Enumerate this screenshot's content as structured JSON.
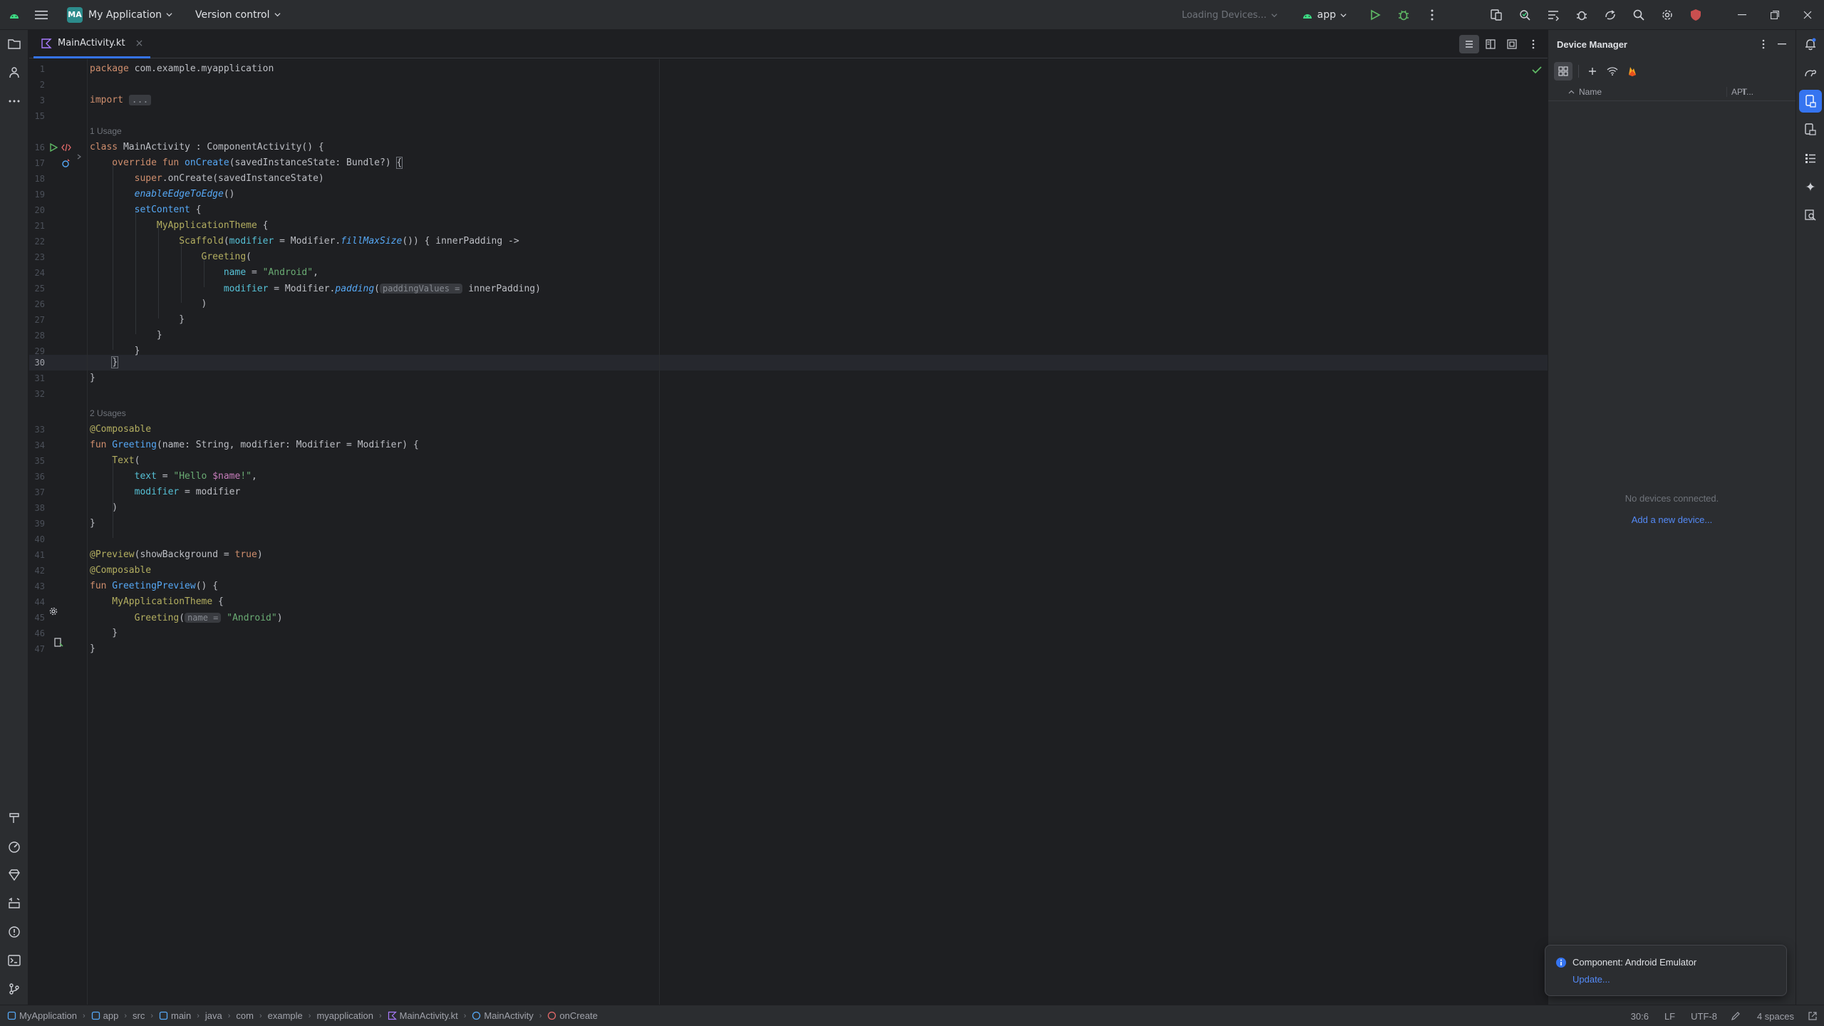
{
  "titlebar": {
    "project_badge": "MA",
    "project_name": "My Application",
    "vcs_label": "Version control",
    "device_selector": "Loading Devices...",
    "run_config": "app"
  },
  "tabs": [
    {
      "label": "MainActivity.kt"
    }
  ],
  "editor": {
    "hints": {
      "h1": "1 Usage",
      "h2": "2 Usages"
    },
    "lines": {
      "l1": "1",
      "l2": "2",
      "l3": "3",
      "l15": "15",
      "l16": "16",
      "l17": "17",
      "l18": "18",
      "l19": "19",
      "l20": "20",
      "l21": "21",
      "l22": "22",
      "l23": "23",
      "l24": "24",
      "l25": "25",
      "l26": "26",
      "l27": "27",
      "l28": "28",
      "l29": "29",
      "l30": "30",
      "l31": "31",
      "l32": "32",
      "l33": "33",
      "l34": "34",
      "l35": "35",
      "l36": "36",
      "l37": "37",
      "l38": "38",
      "l39": "39",
      "l40": "40",
      "l41": "41",
      "l42": "42",
      "l43": "43",
      "l44": "44",
      "l45": "45",
      "l46": "46",
      "l47": "47"
    },
    "code": {
      "c1a": "package",
      "c1b": " com.example.myapplication",
      "c3a": "import",
      "c3b": "...",
      "c16a": "class",
      "c16b": " MainActivity : ComponentActivity() {",
      "c17a": "    override fun",
      "c17b": " onCreate",
      "c17c": "(savedInstanceState: Bundle?) ",
      "c17d": "{",
      "c18a": "        super",
      "c18b": ".onCreate(savedInstanceState)",
      "c19a": "        enableEdgeToEdge",
      "c19b": "()",
      "c20a": "        setContent",
      "c20b": " {",
      "c21a": "            MyApplicationTheme",
      "c21b": " {",
      "c22a": "                Scaffold",
      "c22b": "(",
      "c22c": "modifier",
      "c22d": " = Modifier.",
      "c22e": "fillMaxSize",
      "c22f": "()) { innerPadding ->",
      "c23a": "                    Greeting",
      "c23b": "(",
      "c24a": "                        name",
      "c24b": " = ",
      "c24c": "\"Android\"",
      "c24d": ",",
      "c25a": "                        modifier",
      "c25b": " = Modifier.",
      "c25c": "padding",
      "c25d": "(",
      "c25e": "paddingValues =",
      "c25f": " innerPadding)",
      "c26a": "                    )",
      "c27a": "                }",
      "c28a": "            }",
      "c29a": "        }",
      "c30a": "    ",
      "c30b": "}",
      "c31a": "}",
      "c33a": "@Composable",
      "c34a": "fun",
      "c34b": " Greeting",
      "c34c": "(name: String, modifier: Modifier = Modifier) {",
      "c35a": "    Text",
      "c35b": "(",
      "c36a": "        text",
      "c36b": " = ",
      "c36c": "\"Hello ",
      "c36d": "$name",
      "c36e": "!\"",
      "c36f": ",",
      "c37a": "        modifier",
      "c37b": " = modifier",
      "c38a": "    )",
      "c39a": "}",
      "c41a": "@Preview",
      "c41b": "(showBackground = ",
      "c41c": "true",
      "c41d": ")",
      "c42a": "@Composable",
      "c43a": "fun",
      "c43b": " GreetingPreview",
      "c43c": "() {",
      "c44a": "    MyApplicationTheme",
      "c44b": " {",
      "c45a": "        Greeting",
      "c45b": "(",
      "c45c": "name =",
      "c45d": " ",
      "c45e": "\"Android\"",
      "c45f": ")",
      "c46a": "    }",
      "c47a": "}"
    }
  },
  "device_manager": {
    "title": "Device Manager",
    "col_name": "Name",
    "col_api": "API",
    "col_type": "T...",
    "empty_text": "No devices connected.",
    "add_link": "Add a new device..."
  },
  "notification": {
    "title": "Component: Android Emulator",
    "link": "Update..."
  },
  "statusbar": {
    "crumbs": [
      "MyApplication",
      "app",
      "src",
      "main",
      "java",
      "com",
      "example",
      "myapplication",
      "MainActivity.kt",
      "MainActivity",
      "onCreate"
    ],
    "position": "30:6",
    "line_sep": "LF",
    "encoding": "UTF-8",
    "indent": "4 spaces"
  },
  "colors": {
    "accent": "#3574f0",
    "background": "#1e1f22",
    "panel": "#2b2d30",
    "keyword": "#cf8e6d",
    "function": "#56a8f5",
    "string": "#6aab73",
    "annotation": "#b3ae60"
  },
  "icons": {
    "title": [
      "android-icon",
      "menu-icon",
      "chevron-down-icon",
      "run-icon",
      "debug-icon",
      "more-icon",
      "device-mirror-icon",
      "app-inspection-icon",
      "layout-icon",
      "bug-icon",
      "sync-icon",
      "search-icon",
      "settings-icon",
      "shield-icon",
      "minimize-icon",
      "restore-icon",
      "close-icon"
    ],
    "left": [
      "folder-icon",
      "commit-icon",
      "more-icon",
      "build-icon",
      "profiler-icon",
      "gem-icon",
      "logcat-icon",
      "problems-icon",
      "terminal-icon",
      "git-icon"
    ],
    "right": [
      "notifications-icon",
      "gradle-icon",
      "device-manager-icon",
      "device-explorer-icon",
      "structure-icon",
      "gemini-icon",
      "inspect-icon"
    ]
  }
}
